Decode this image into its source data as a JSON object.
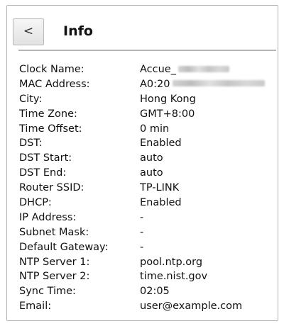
{
  "header": {
    "back_label": "<",
    "title": "Info"
  },
  "info_rows": [
    {
      "label": "Clock Name:",
      "value": "Accue_"
    },
    {
      "label": "MAC Address:",
      "value": "A0:20"
    },
    {
      "label": "City:",
      "value": "Hong Kong"
    },
    {
      "label": "Time Zone:",
      "value": "GMT+8:00"
    },
    {
      "label": "Time Offset:",
      "value": "0 min"
    },
    {
      "label": "DST:",
      "value": "Enabled"
    },
    {
      "label": "DST Start:",
      "value": "auto"
    },
    {
      "label": "DST End:",
      "value": "auto"
    },
    {
      "label": "Router SSID:",
      "value": "TP-LINK"
    },
    {
      "label": "DHCP:",
      "value": "Enabled"
    },
    {
      "label": "IP Address:",
      "value": "-"
    },
    {
      "label": "Subnet Mask:",
      "value": "-"
    },
    {
      "label": "Default Gateway:",
      "value": "-"
    },
    {
      "label": "NTP Server 1:",
      "value": "pool.ntp.org"
    },
    {
      "label": "NTP Server 2:",
      "value": "time.nist.gov"
    },
    {
      "label": "Sync Time:",
      "value": "02:05"
    },
    {
      "label": "Email:",
      "value": "user@example.com"
    }
  ]
}
